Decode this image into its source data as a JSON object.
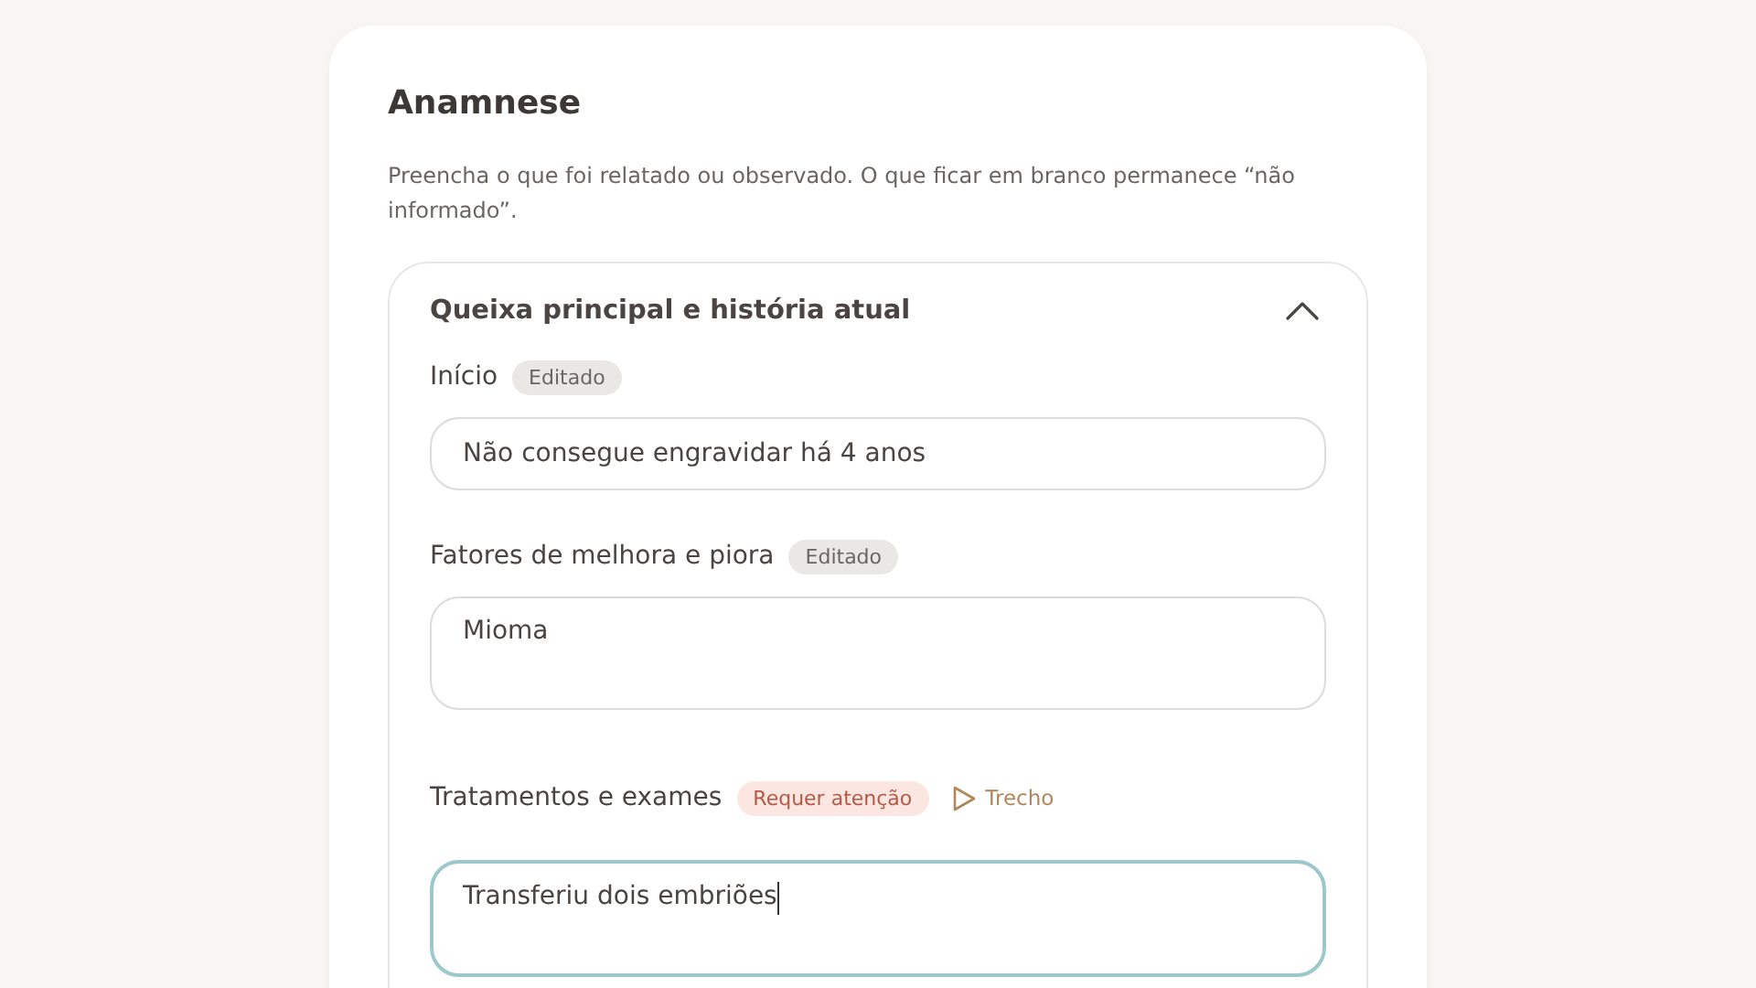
{
  "card": {
    "title": "Anamnese",
    "description": "Preencha o que foi relatado ou observado. O que ficar em branco permanece “não informado”."
  },
  "section": {
    "title": "Queixa principal e história atual",
    "expanded": true,
    "fields": [
      {
        "label": "Início",
        "badges": [
          {
            "kind": "edited",
            "text": "Editado"
          }
        ],
        "value": "Não consegue engravidar há 4 anos",
        "multiline": false,
        "focused": false
      },
      {
        "label": "Fatores de melhora e piora",
        "badges": [
          {
            "kind": "edited",
            "text": "Editado"
          }
        ],
        "value": "Mioma",
        "multiline": true,
        "focused": false
      },
      {
        "label": "Tratamentos e exames",
        "badges": [
          {
            "kind": "attention",
            "text": "Requer atenção"
          }
        ],
        "link": "Trecho",
        "value": "Transferiu dois embriões",
        "multiline": true,
        "focused": true
      }
    ]
  }
}
